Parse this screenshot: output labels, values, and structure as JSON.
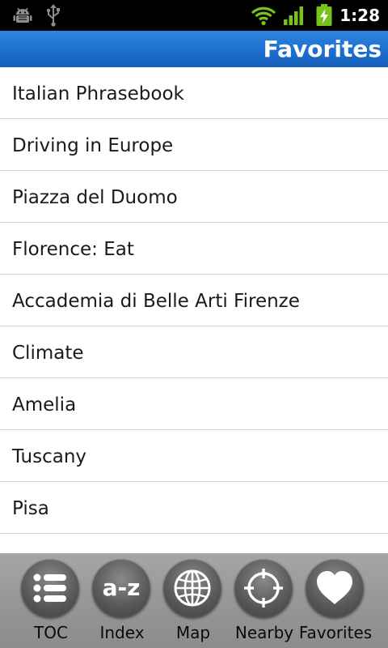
{
  "status_bar": {
    "time": "1:28",
    "icons": [
      "android-debug-icon",
      "usb-icon",
      "wifi-icon",
      "signal-icon",
      "battery-charging-icon"
    ]
  },
  "title_bar": {
    "title": "Favorites",
    "color": "#1c6fcf"
  },
  "favorites": [
    {
      "label": "Italian Phrasebook"
    },
    {
      "label": "Driving in Europe"
    },
    {
      "label": "Piazza del Duomo"
    },
    {
      "label": "Florence: Eat"
    },
    {
      "label": "Accademia di Belle Arti Firenze"
    },
    {
      "label": "Climate"
    },
    {
      "label": "Amelia"
    },
    {
      "label": "Tuscany"
    },
    {
      "label": "Pisa"
    },
    {
      "label": ""
    }
  ],
  "toolbar": {
    "buttons": [
      {
        "label": "TOC",
        "icon": "list-icon"
      },
      {
        "label": "Index",
        "icon": "a-z-icon",
        "icon_text": "a-z"
      },
      {
        "label": "Map",
        "icon": "globe-icon"
      },
      {
        "label": "Nearby",
        "icon": "crosshair-icon"
      },
      {
        "label": "Favorites",
        "icon": "heart-icon"
      }
    ]
  }
}
